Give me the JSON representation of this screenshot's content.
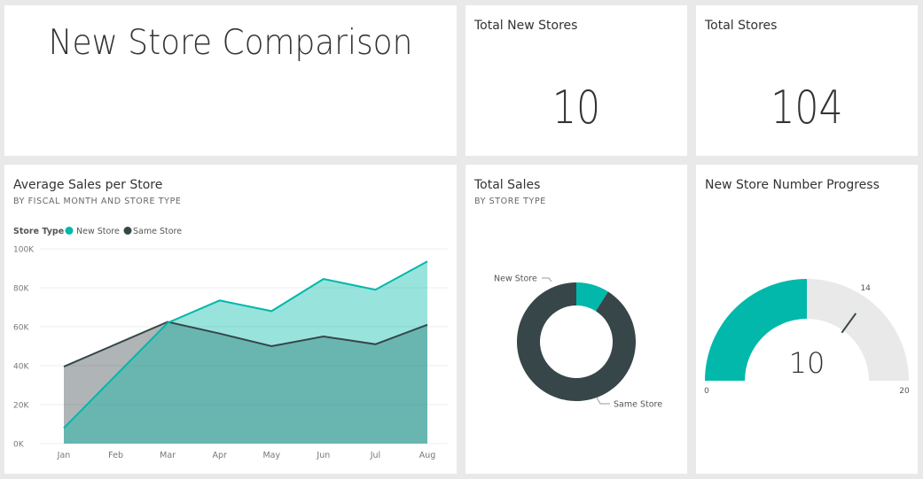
{
  "dashboard": {
    "title": "New Store Comparison"
  },
  "cards": {
    "total_new_stores": {
      "label": "Total New Stores",
      "value": "10"
    },
    "total_stores": {
      "label": "Total Stores",
      "value": "104"
    }
  },
  "avg_sales": {
    "title": "Average Sales per Store",
    "subtitle": "BY FISCAL MONTH AND STORE TYPE",
    "legend_title": "Store Type",
    "colors": {
      "new_store": "#01b8aa",
      "same_store": "#374649"
    }
  },
  "total_sales": {
    "title": "Total Sales",
    "subtitle": "BY STORE TYPE",
    "label_new": "New Store",
    "label_same": "Same Store"
  },
  "gauge": {
    "title": "New Store Number Progress",
    "value": 10,
    "value_text": "10",
    "min": 0,
    "max": 20,
    "target": 14,
    "min_text": "0",
    "max_text": "20",
    "target_text": "14"
  },
  "chart_data": [
    {
      "type": "area",
      "title": "Average Sales per Store",
      "subtitle": "BY FISCAL MONTH AND STORE TYPE",
      "categories": [
        "Jan",
        "Feb",
        "Mar",
        "Apr",
        "May",
        "Jun",
        "Jul",
        "Aug"
      ],
      "series": [
        {
          "name": "New Store",
          "color": "#01b8aa",
          "values": [
            8000,
            35000,
            62000,
            73500,
            68000,
            84500,
            79000,
            93500
          ]
        },
        {
          "name": "Same Store",
          "color": "#374649",
          "values": [
            39500,
            51000,
            62500,
            56500,
            50000,
            55000,
            51000,
            61000
          ]
        }
      ],
      "y_ticks": [
        "0K",
        "20K",
        "40K",
        "60K",
        "80K",
        "100K"
      ],
      "ylim": [
        0,
        100000
      ],
      "legend": "top-left",
      "grid": true
    },
    {
      "type": "pie",
      "variant": "donut",
      "title": "Total Sales",
      "subtitle": "BY STORE TYPE",
      "categories": [
        "New Store",
        "Same Store"
      ],
      "values": [
        9,
        91
      ],
      "colors": [
        "#01b8aa",
        "#374649"
      ]
    }
  ]
}
